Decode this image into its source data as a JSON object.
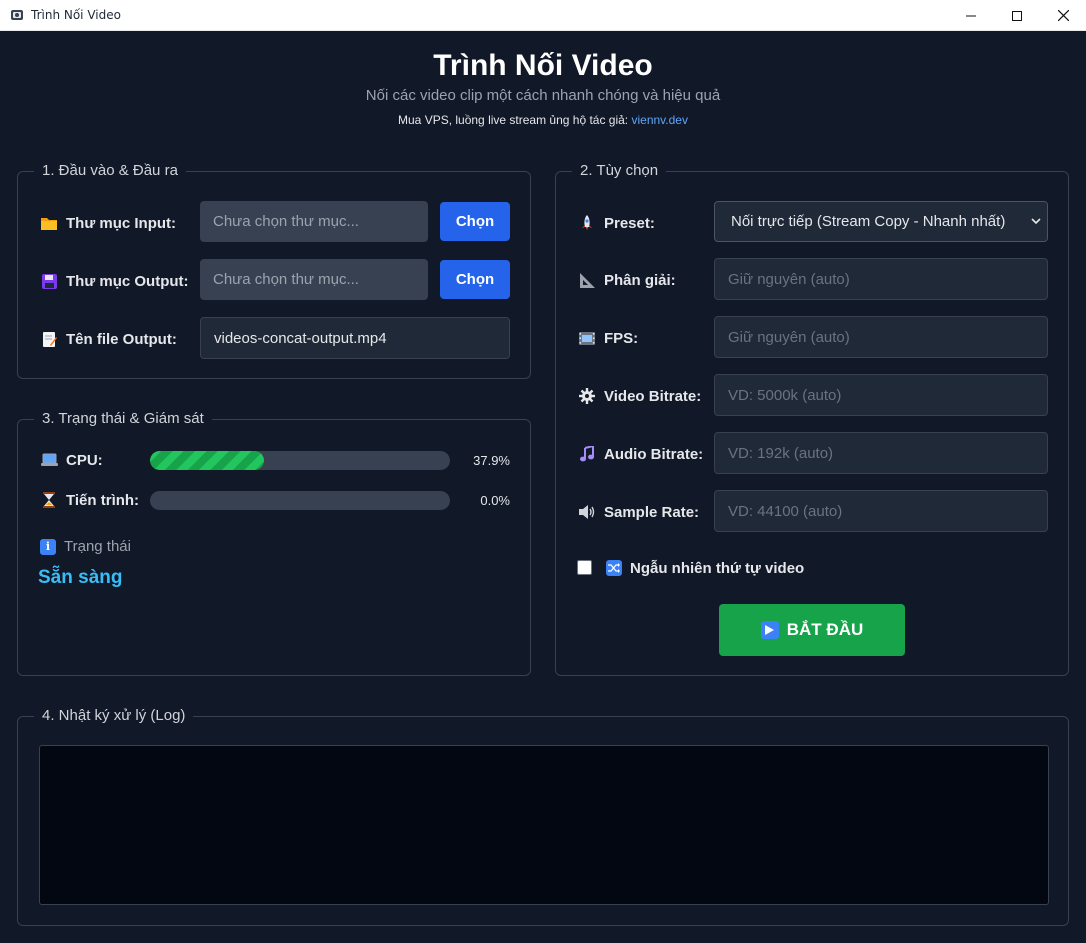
{
  "window": {
    "title": "Trình Nối Video",
    "controls": {
      "minimize": "—",
      "maximize": "☐",
      "close": "✕"
    }
  },
  "header": {
    "title": "Trình Nối Video",
    "subtitle": "Nối các video clip một cách nhanh chóng và hiệu quả",
    "promo_text": "Mua VPS, luồng live stream ủng hộ tác giả: ",
    "promo_link": "viennv.dev"
  },
  "io_panel": {
    "legend": "1. Đầu vào & Đầu ra",
    "input_folder": {
      "label": "Thư mục Input:",
      "placeholder": "Chưa chọn thư mục...",
      "button": "Chọn",
      "icon": "folder-icon"
    },
    "output_folder": {
      "label": "Thư mục Output:",
      "placeholder": "Chưa chọn thư mục...",
      "button": "Chọn",
      "icon": "floppy-icon"
    },
    "output_file": {
      "label": "Tên file Output:",
      "value": "videos-concat-output.mp4",
      "icon": "memo-icon"
    }
  },
  "status_panel": {
    "legend": "3. Trạng thái & Giám sát",
    "cpu": {
      "label": "CPU:",
      "percent_text": "37.9%",
      "fraction": 0.379,
      "icon": "laptop-icon"
    },
    "progress": {
      "label": "Tiến trình:",
      "percent_text": "0.0%",
      "fraction": 0.0,
      "icon": "hourglass-icon"
    },
    "status": {
      "label": "Trạng thái",
      "value": "Sẵn sàng",
      "icon": "info-icon"
    }
  },
  "options_panel": {
    "legend": "2. Tùy chọn",
    "preset": {
      "label": "Preset:",
      "value": "Nối trực tiếp (Stream Copy - Nhanh nhất)",
      "icon": "rocket-icon"
    },
    "resolution": {
      "label": "Phân giải:",
      "placeholder": "Giữ nguyên (auto)",
      "icon": "ruler-icon"
    },
    "fps": {
      "label": "FPS:",
      "placeholder": "Giữ nguyên (auto)",
      "icon": "film-icon"
    },
    "video_bitrate": {
      "label": "Video Bitrate:",
      "placeholder": "VD: 5000k (auto)",
      "icon": "gear-icon"
    },
    "audio_bitrate": {
      "label": "Audio Bitrate:",
      "placeholder": "VD: 192k (auto)",
      "icon": "music-note-icon"
    },
    "sample_rate": {
      "label": "Sample Rate:",
      "placeholder": "VD: 44100 (auto)",
      "icon": "speaker-icon"
    },
    "shuffle": {
      "label": "Ngẫu nhiên thứ tự video",
      "checked": false,
      "icon": "shuffle-icon"
    },
    "start_button": "BẮT ĐẦU"
  },
  "log_panel": {
    "legend": "4. Nhật ký xử lý (Log)"
  },
  "colors": {
    "background": "#111827",
    "accent_blue": "#2563eb",
    "start_green": "#16a34a",
    "status_cyan": "#38bdf8"
  }
}
